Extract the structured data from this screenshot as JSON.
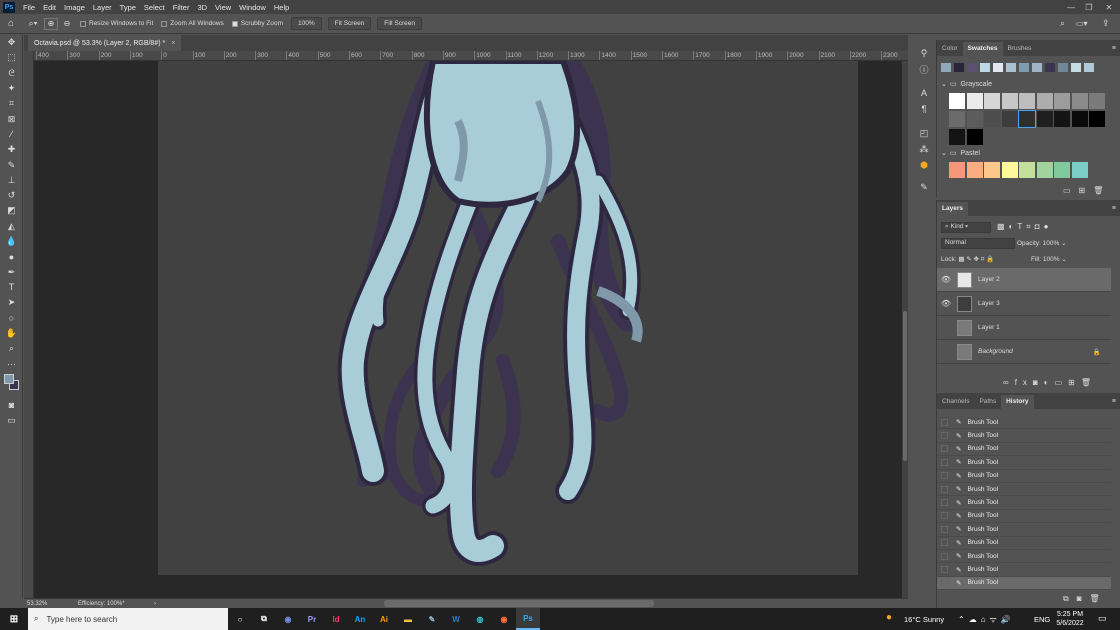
{
  "app": {
    "logo": "Ps"
  },
  "menu": [
    "File",
    "Edit",
    "Image",
    "Layer",
    "Type",
    "Select",
    "Filter",
    "3D",
    "View",
    "Window",
    "Help"
  ],
  "options": {
    "resize_windows": "Resize Windows to Fit",
    "zoom_all": "Zoom All Windows",
    "scrubby_zoom": "Scrubby Zoom",
    "zoom_value": "100%",
    "fit_screen": "Fit Screen",
    "fill_screen": "Fill Screen"
  },
  "document": {
    "tab_title": "Octavia.psd @ 53.3% (Layer 2, RGB/8#) *",
    "close": "×"
  },
  "ruler": {
    "labels": [
      "400",
      "300",
      "200",
      "100",
      "0",
      "100",
      "200",
      "300",
      "400",
      "500",
      "600",
      "700",
      "800",
      "900",
      "1000",
      "1100",
      "1200",
      "1300",
      "1400",
      "1500",
      "1600",
      "1700",
      "1800",
      "1900",
      "2000",
      "2100",
      "2200",
      "2300"
    ]
  },
  "status": {
    "zoom": "53.32%",
    "info": "Efficiency: 100%*",
    "arrow": "›"
  },
  "swatches_panel": {
    "tabs": [
      "Color",
      "Swatches",
      "Brushes"
    ],
    "active_tab": "Swatches",
    "recent_colors": [
      "#8fa9b8",
      "#2a2438",
      "#5c5070",
      "#bdd9e4",
      "#dfe8ee",
      "#a8c2d0",
      "#7f9bb0",
      "#9fb4c4",
      "#3a3450",
      "#6f8799",
      "#c7dbe5",
      "#b0c8d6"
    ],
    "groups": [
      {
        "name": "Grayscale",
        "colors": [
          "#ffffff",
          "#ebebeb",
          "#d6d6d6",
          "#c7c7c7",
          "#bdbdbd",
          "#adadad",
          "#9c9c9c",
          "#8a8a8a",
          "#7a7a7a",
          "#6b6b6b",
          "#5c5c5c",
          "#4d4d4d",
          "#3d3d3d",
          "#2e2e2e",
          "#1f1f1f",
          "#141414",
          "#0a0a0a",
          "#000000"
        ]
      },
      {
        "name": "Pastel",
        "colors": [
          "#f7977a",
          "#f9ad81",
          "#fdc68a",
          "#fff79a",
          "#c4df9b",
          "#a2d39c",
          "#82ca9d",
          "#7bcdc8"
        ]
      }
    ]
  },
  "layers_panel": {
    "title": "Layers",
    "kind": "Kind",
    "blend_mode": "Normal",
    "opacity_label": "Opacity:",
    "opacity": "100%",
    "lock_label": "Lock:",
    "fill_label": "Fill:",
    "fill": "100%",
    "layers": [
      {
        "name": "Layer 2",
        "visible": true,
        "selected": true
      },
      {
        "name": "Layer 3",
        "visible": true,
        "selected": false
      },
      {
        "name": "Layer 1",
        "visible": false,
        "selected": false
      },
      {
        "name": "Background",
        "visible": false,
        "selected": false
      }
    ]
  },
  "history_panel": {
    "tabs": [
      "Channels",
      "Paths",
      "History"
    ],
    "active_tab": "History",
    "items": [
      "Brush Tool",
      "Brush Tool",
      "Brush Tool",
      "Brush Tool",
      "Brush Tool",
      "Brush Tool",
      "Brush Tool",
      "Brush Tool",
      "Brush Tool",
      "Brush Tool",
      "Brush Tool",
      "Brush Tool",
      "Brush Tool"
    ]
  },
  "taskbar": {
    "search_placeholder": "Type here to search",
    "apps": [
      "Pr",
      "Id",
      "An",
      "Ai",
      "W",
      "Ps"
    ],
    "weather": "16°C  Sunny",
    "lang": "ENG",
    "time": "5:25 PM",
    "date": "5/6/2022"
  },
  "colors": {
    "accent": "#31a8ff",
    "tentacle_light": "#a8ccd8",
    "tentacle_dark": "#3b334f",
    "tentacle_mid": "#7f98aa"
  }
}
